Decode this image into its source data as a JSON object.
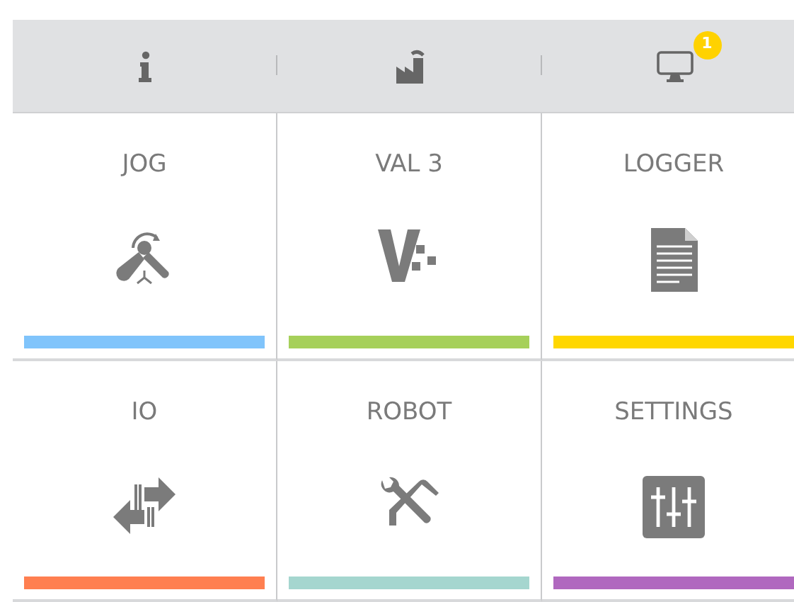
{
  "toolbar": [
    {
      "kind": "info"
    },
    {
      "kind": "factory"
    },
    {
      "kind": "monitor",
      "badge": "1"
    }
  ],
  "tiles": [
    {
      "label": "JOG",
      "kind": "jog",
      "color": "#80c4fb"
    },
    {
      "label": "VAL 3",
      "kind": "val3",
      "color": "#a6d05a"
    },
    {
      "label": "LOGGER",
      "kind": "logger",
      "color": "#ffd700"
    },
    {
      "label": "IO",
      "kind": "io",
      "color": "#ff7f50"
    },
    {
      "label": "ROBOT",
      "kind": "robot",
      "color": "#a5d6cf"
    },
    {
      "label": "SETTINGS",
      "kind": "settings",
      "color": "#b068bf"
    }
  ]
}
